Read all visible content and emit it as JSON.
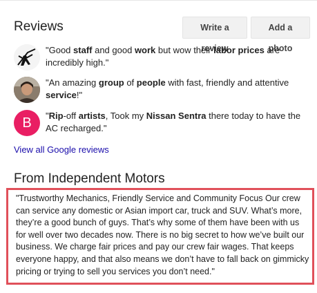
{
  "reviews_section": {
    "title": "Reviews",
    "write_review_label": "Write a review",
    "add_photo_label": "Add a photo"
  },
  "reviews": [
    {
      "avatar": "silhouette-photo",
      "segments": [
        {
          "t": "\"Good ",
          "b": false
        },
        {
          "t": "staff",
          "b": true
        },
        {
          "t": " and good ",
          "b": false
        },
        {
          "t": "work",
          "b": true
        },
        {
          "t": " but wow their ",
          "b": false
        },
        {
          "t": "labor prices",
          "b": true
        },
        {
          "t": " are incredibly high.\"",
          "b": false
        }
      ]
    },
    {
      "avatar": "person-photo",
      "segments": [
        {
          "t": "\"An amazing ",
          "b": false
        },
        {
          "t": "group",
          "b": true
        },
        {
          "t": " of ",
          "b": false
        },
        {
          "t": "people",
          "b": true
        },
        {
          "t": " with fast, friendly and attentive ",
          "b": false
        },
        {
          "t": "service",
          "b": true
        },
        {
          "t": "!\"",
          "b": false
        }
      ]
    },
    {
      "avatar": "letter",
      "avatar_letter": "B",
      "avatar_color": "#e91e63",
      "segments": [
        {
          "t": "\"",
          "b": false
        },
        {
          "t": "Rip",
          "b": true
        },
        {
          "t": "-off ",
          "b": false
        },
        {
          "t": "artists",
          "b": true
        },
        {
          "t": ", Took my ",
          "b": false
        },
        {
          "t": "Nissan Sentra",
          "b": true
        },
        {
          "t": " there today to have the AC recharged.\"",
          "b": false
        }
      ]
    }
  ],
  "view_all_label": "View all Google reviews",
  "from_section": {
    "title": "From Independent Motors",
    "description": "\"Trustworthy Mechanics, Friendly Service and Community Focus Our crew can service any domestic or Asian import car, truck and SUV. What’s more, they’re a good bunch of guys. That’s why some of them have been with us for well over two decades now. There is no big secret to how we’ve built our business. We charge fair prices and pay our crew fair wages. That keeps everyone happy, and that also means we don’t have to fall back on gimmicky pricing or trying to sell you services you don’t need.\""
  },
  "colors": {
    "link": "#1a0dab",
    "highlight_border": "#e0505a",
    "letter_avatar": "#e91e63"
  }
}
